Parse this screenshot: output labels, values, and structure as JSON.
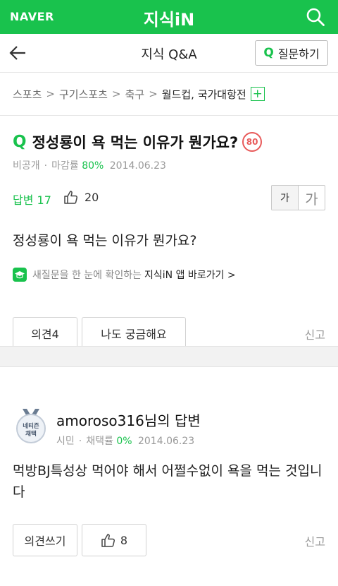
{
  "header": {
    "logo": "NAVER",
    "title": "지식iN",
    "search_icon": "search-icon"
  },
  "subheader": {
    "title": "지식 Q&A",
    "ask_q": "Q",
    "ask_label": "질문하기"
  },
  "breadcrumb": {
    "items": [
      "스포츠",
      "구기스포츠",
      "축구",
      "월드컵, 국가대항전"
    ],
    "separator": ">",
    "add": "+"
  },
  "question": {
    "q_mark": "Q",
    "title": "정성룡이 욕 먹는 이유가 뭔가요?",
    "points": "80",
    "author": "비공개",
    "close_label": "마감률",
    "close_rate": "80%",
    "date": "2014.06.23",
    "answers_label": "답변 17",
    "likes": "20",
    "font_small": "가",
    "font_big": "가",
    "body": "정성룡이 욕 먹는 이유가 뭔가요?",
    "promo_text": "새질문을 한 눈에 확인하는",
    "promo_app": "지식iN 앱 바로가기 >",
    "opinion_btn": "의견4",
    "curious_btn": "나도 궁금해요",
    "report": "신고"
  },
  "answer": {
    "badge_line1": "네티즌",
    "badge_line2": "채택",
    "title": "amoroso316님의 답변",
    "rank": "시민",
    "adopt_label": "채택률",
    "adopt_rate": "0%",
    "date": "2014.06.23",
    "body": "먹방BJ특성상 먹어야 해서 어쩔수없이 욕을 먹는 것입니다",
    "opinion_btn": "의견쓰기",
    "likes": "8",
    "report": "신고"
  },
  "colors": {
    "brand": "#19c24d",
    "points": "#e85a5a"
  }
}
